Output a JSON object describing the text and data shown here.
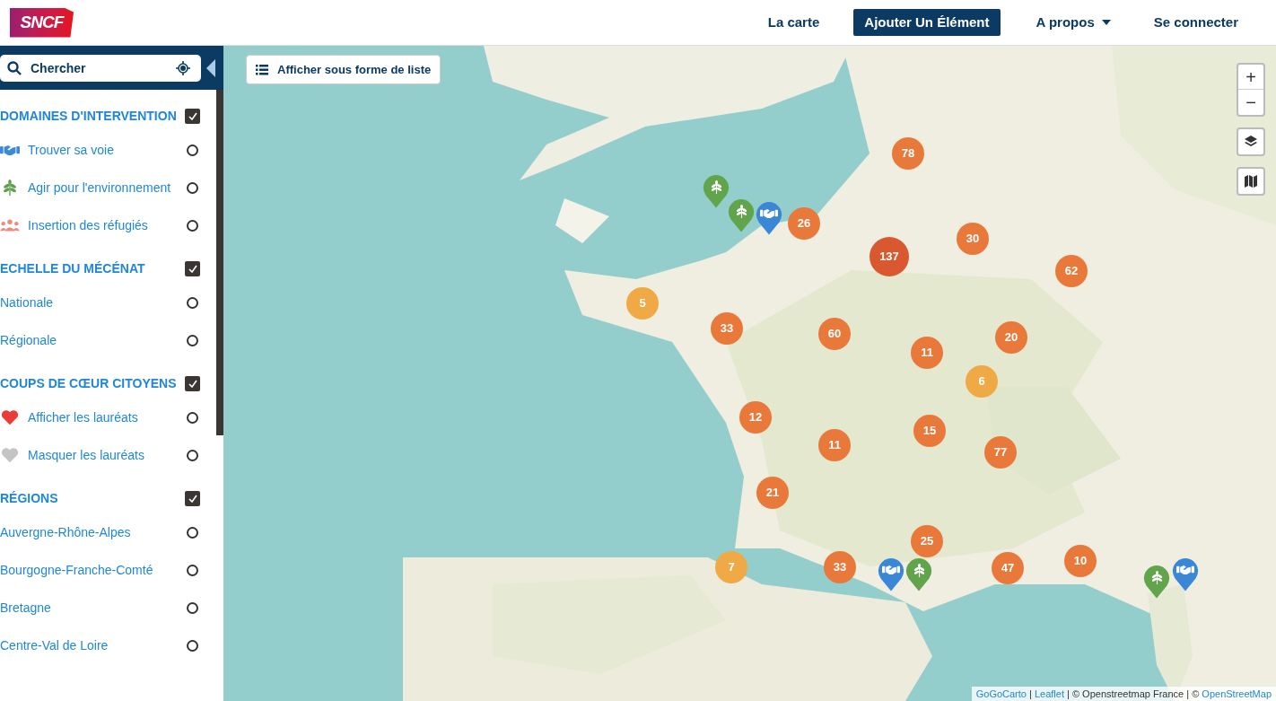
{
  "header": {
    "logo": "SNCF",
    "nav": [
      {
        "label": "La carte",
        "kind": "link"
      },
      {
        "label": "Ajouter Un Élément",
        "kind": "primary"
      },
      {
        "label": "A propos",
        "kind": "dropdown"
      },
      {
        "label": "Se connecter",
        "kind": "link"
      }
    ]
  },
  "sidebar": {
    "search": {
      "placeholder": "Chercher"
    },
    "sections": [
      {
        "title": "DOMAINES D'INTERVENTION",
        "checked": true,
        "items": [
          {
            "label": "Trouver sa voie",
            "kind": "handshake",
            "selected": false
          },
          {
            "label": "Agir pour l'environnement",
            "kind": "leaf",
            "selected": false
          },
          {
            "label": "Insertion des réfugiés",
            "kind": "people",
            "selected": false
          }
        ]
      },
      {
        "title": "ECHELLE DU MÉCÉNAT",
        "checked": true,
        "items": [
          {
            "label": "Nationale",
            "kind": "plain",
            "selected": false
          },
          {
            "label": "Régionale",
            "kind": "plain",
            "selected": false
          }
        ]
      },
      {
        "title": "COUPS DE CŒUR CITOYENS",
        "checked": true,
        "items": [
          {
            "label": "Afficher les lauréats",
            "kind": "heart",
            "selected": false
          },
          {
            "label": "Masquer les lauréats",
            "kind": "heart-off",
            "selected": false
          }
        ]
      },
      {
        "title": "RÉGIONS",
        "checked": true,
        "items": [
          {
            "label": "Auvergne-Rhône-Alpes",
            "kind": "plain",
            "selected": false
          },
          {
            "label": "Bourgogne-Franche-Comté",
            "kind": "plain",
            "selected": false
          },
          {
            "label": "Bretagne",
            "kind": "plain",
            "selected": false
          },
          {
            "label": "Centre-Val de Loire",
            "kind": "plain",
            "selected": false
          }
        ]
      }
    ]
  },
  "map": {
    "list_button": "Afficher sous forme de liste",
    "zoom_in": "+",
    "zoom_out": "−",
    "markers": [
      {
        "kind": "cluster",
        "count": "78",
        "color": "#e8793a"
      },
      {
        "kind": "cluster",
        "count": "26",
        "color": "#e8793a"
      },
      {
        "kind": "cluster",
        "count": "137",
        "color": "#d9582f"
      },
      {
        "kind": "cluster",
        "count": "30",
        "color": "#e8793a"
      },
      {
        "kind": "cluster",
        "count": "62",
        "color": "#e8793a"
      },
      {
        "kind": "cluster",
        "count": "5",
        "color": "#efaa45"
      },
      {
        "kind": "cluster",
        "count": "33",
        "color": "#e8793a"
      },
      {
        "kind": "cluster",
        "count": "60",
        "color": "#e8793a"
      },
      {
        "kind": "cluster",
        "count": "20",
        "color": "#e8793a"
      },
      {
        "kind": "cluster",
        "count": "11",
        "color": "#e8793a"
      },
      {
        "kind": "cluster",
        "count": "6",
        "color": "#efaa45"
      },
      {
        "kind": "cluster",
        "count": "12",
        "color": "#e8793a"
      },
      {
        "kind": "cluster",
        "count": "15",
        "color": "#e8793a"
      },
      {
        "kind": "cluster",
        "count": "11",
        "color": "#e8793a"
      },
      {
        "kind": "cluster",
        "count": "77",
        "color": "#e8793a"
      },
      {
        "kind": "cluster",
        "count": "21",
        "color": "#e8793a"
      },
      {
        "kind": "cluster",
        "count": "25",
        "color": "#e8793a"
      },
      {
        "kind": "cluster",
        "count": "7",
        "color": "#efaa45"
      },
      {
        "kind": "cluster",
        "count": "33",
        "color": "#e8793a"
      },
      {
        "kind": "cluster",
        "count": "47",
        "color": "#e8793a"
      },
      {
        "kind": "cluster",
        "count": "10",
        "color": "#e8793a"
      },
      {
        "kind": "leaf-pin"
      },
      {
        "kind": "leaf-pin"
      },
      {
        "kind": "handshake-pin"
      },
      {
        "kind": "handshake-pin"
      },
      {
        "kind": "leaf-pin"
      },
      {
        "kind": "handshake-pin"
      },
      {
        "kind": "leaf-pin"
      }
    ],
    "attribution": [
      {
        "text": "GoGoCarto",
        "kind": "link"
      },
      {
        "text": " | ",
        "kind": "text"
      },
      {
        "text": "Leaflet",
        "kind": "link"
      },
      {
        "text": " | © Openstreetmap France | © ",
        "kind": "text"
      },
      {
        "text": "OpenStreetMap",
        "kind": "link"
      }
    ]
  }
}
